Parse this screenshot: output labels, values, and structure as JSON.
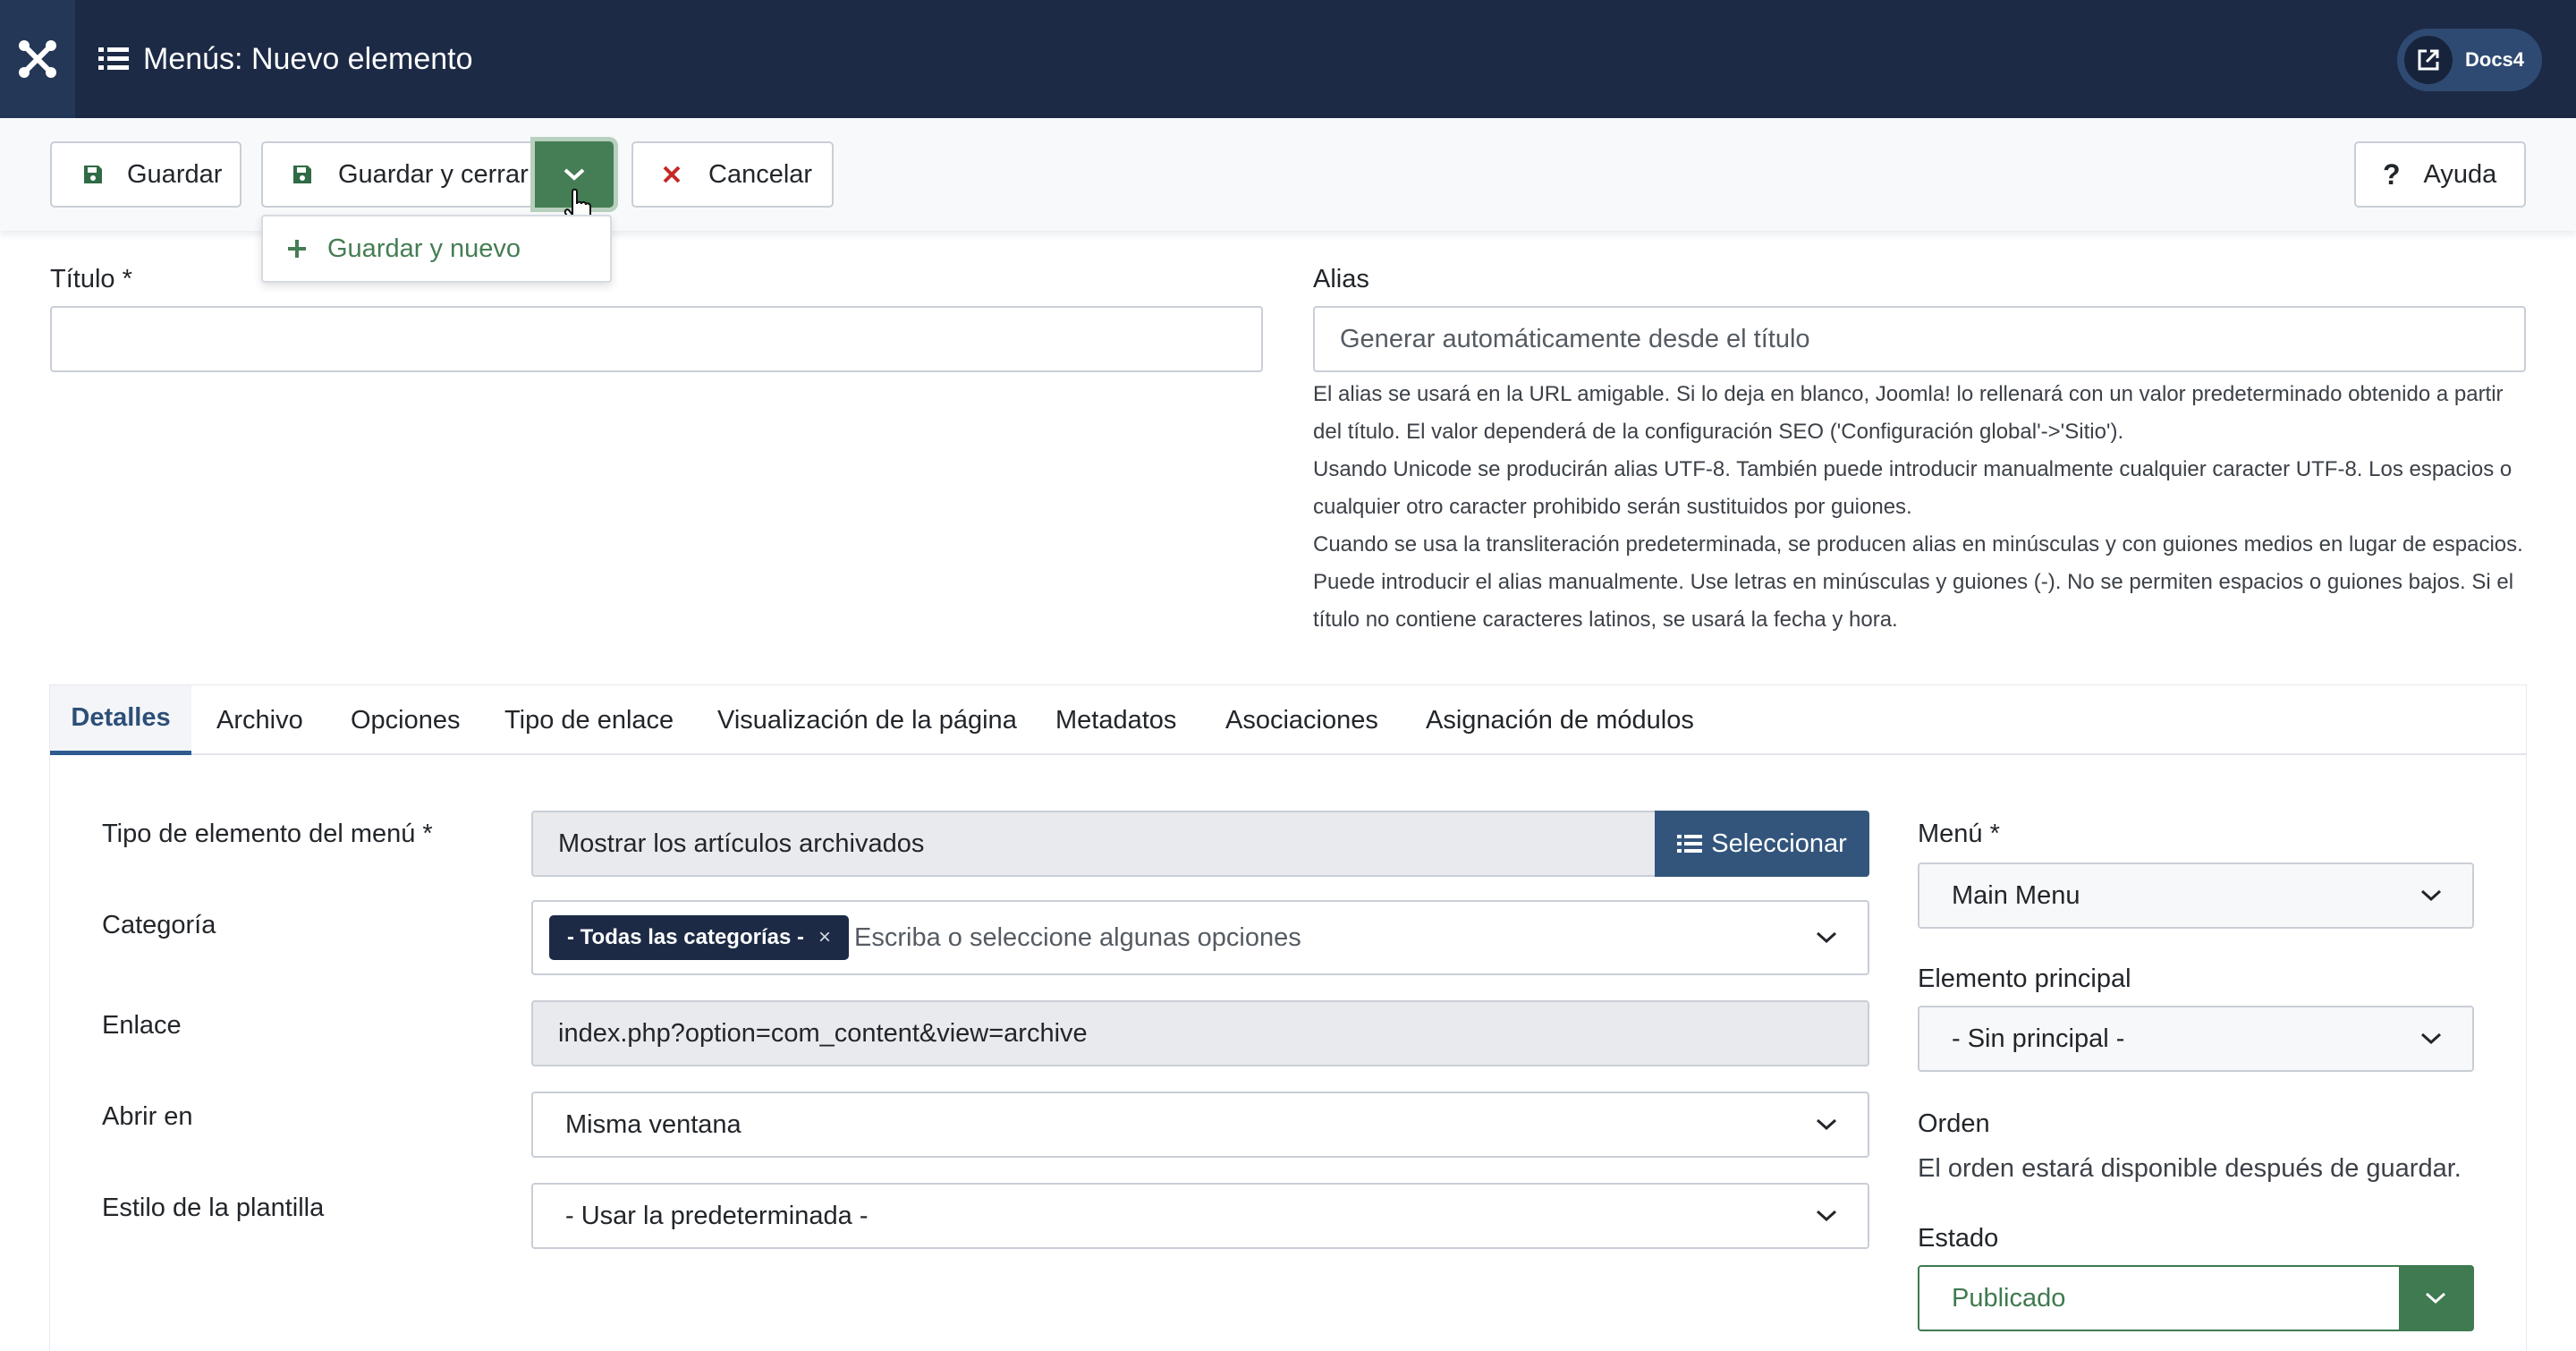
{
  "header": {
    "title": "Menús: Nuevo elemento",
    "docs_label": "Docs4"
  },
  "toolbar": {
    "save_label": "Guardar",
    "save_close_label": "Guardar y cerrar",
    "cancel_label": "Cancelar",
    "help_label": "Ayuda",
    "dropdown_item_label": "Guardar y nuevo"
  },
  "form": {
    "title_label": "Título *",
    "title_value": "",
    "alias_label": "Alias",
    "alias_placeholder": "Generar automáticamente desde el título",
    "alias_help": [
      "El alias se usará en la URL amigable. Si lo deja en blanco, Joomla! lo rellenará con un valor predeterminado obtenido a partir del título. El valor dependerá de la configuración SEO ('Configuración global'->'Sitio').",
      "Usando Unicode se producirán alias UTF-8. También puede introducir manualmente cualquier caracter UTF-8. Los espacios o cualquier otro caracter prohibido serán sustituidos por guiones.",
      "Cuando se usa la transliteración predeterminada, se producen alias en minúsculas y con guiones medios en lugar de espacios. Puede introducir el alias manualmente. Use letras en minúsculas y guiones (-). No se permiten espacios o guiones bajos. Si el título no contiene caracteres latinos, se usará la fecha y hora."
    ]
  },
  "tabs": [
    {
      "label": "Detalles",
      "active": true
    },
    {
      "label": "Archivo"
    },
    {
      "label": "Opciones"
    },
    {
      "label": "Tipo de enlace"
    },
    {
      "label": "Visualización de la página"
    },
    {
      "label": "Metadatos"
    },
    {
      "label": "Asociaciones"
    },
    {
      "label": "Asignación de módulos"
    }
  ],
  "details": {
    "menu_item_type_label": "Tipo de elemento del menú *",
    "menu_item_type_value": "Mostrar los artículos archivados",
    "select_button_label": "Seleccionar",
    "category_label": "Categoría",
    "category_chip": "- Todas las categorías -",
    "category_chip_remove": "×",
    "category_placeholder": "Escriba o seleccione algunas opciones",
    "link_label": "Enlace",
    "link_value": "index.php?option=com_content&view=archive",
    "open_in_label": "Abrir en",
    "open_in_value": "Misma ventana",
    "template_style_label": "Estilo de la plantilla",
    "template_style_value": "- Usar la predeterminada -"
  },
  "sidebar": {
    "menu_label": "Menú *",
    "menu_value": "Main Menu",
    "parent_label": "Elemento principal",
    "parent_value": "- Sin principal -",
    "order_label": "Orden",
    "order_text": "El orden estará disponible después de guardar.",
    "status_label": "Estado",
    "status_value": "Publicado"
  },
  "colors": {
    "header_bg": "#1c2a46",
    "accent_green": "#457d54",
    "accent_blue": "#33557c"
  }
}
